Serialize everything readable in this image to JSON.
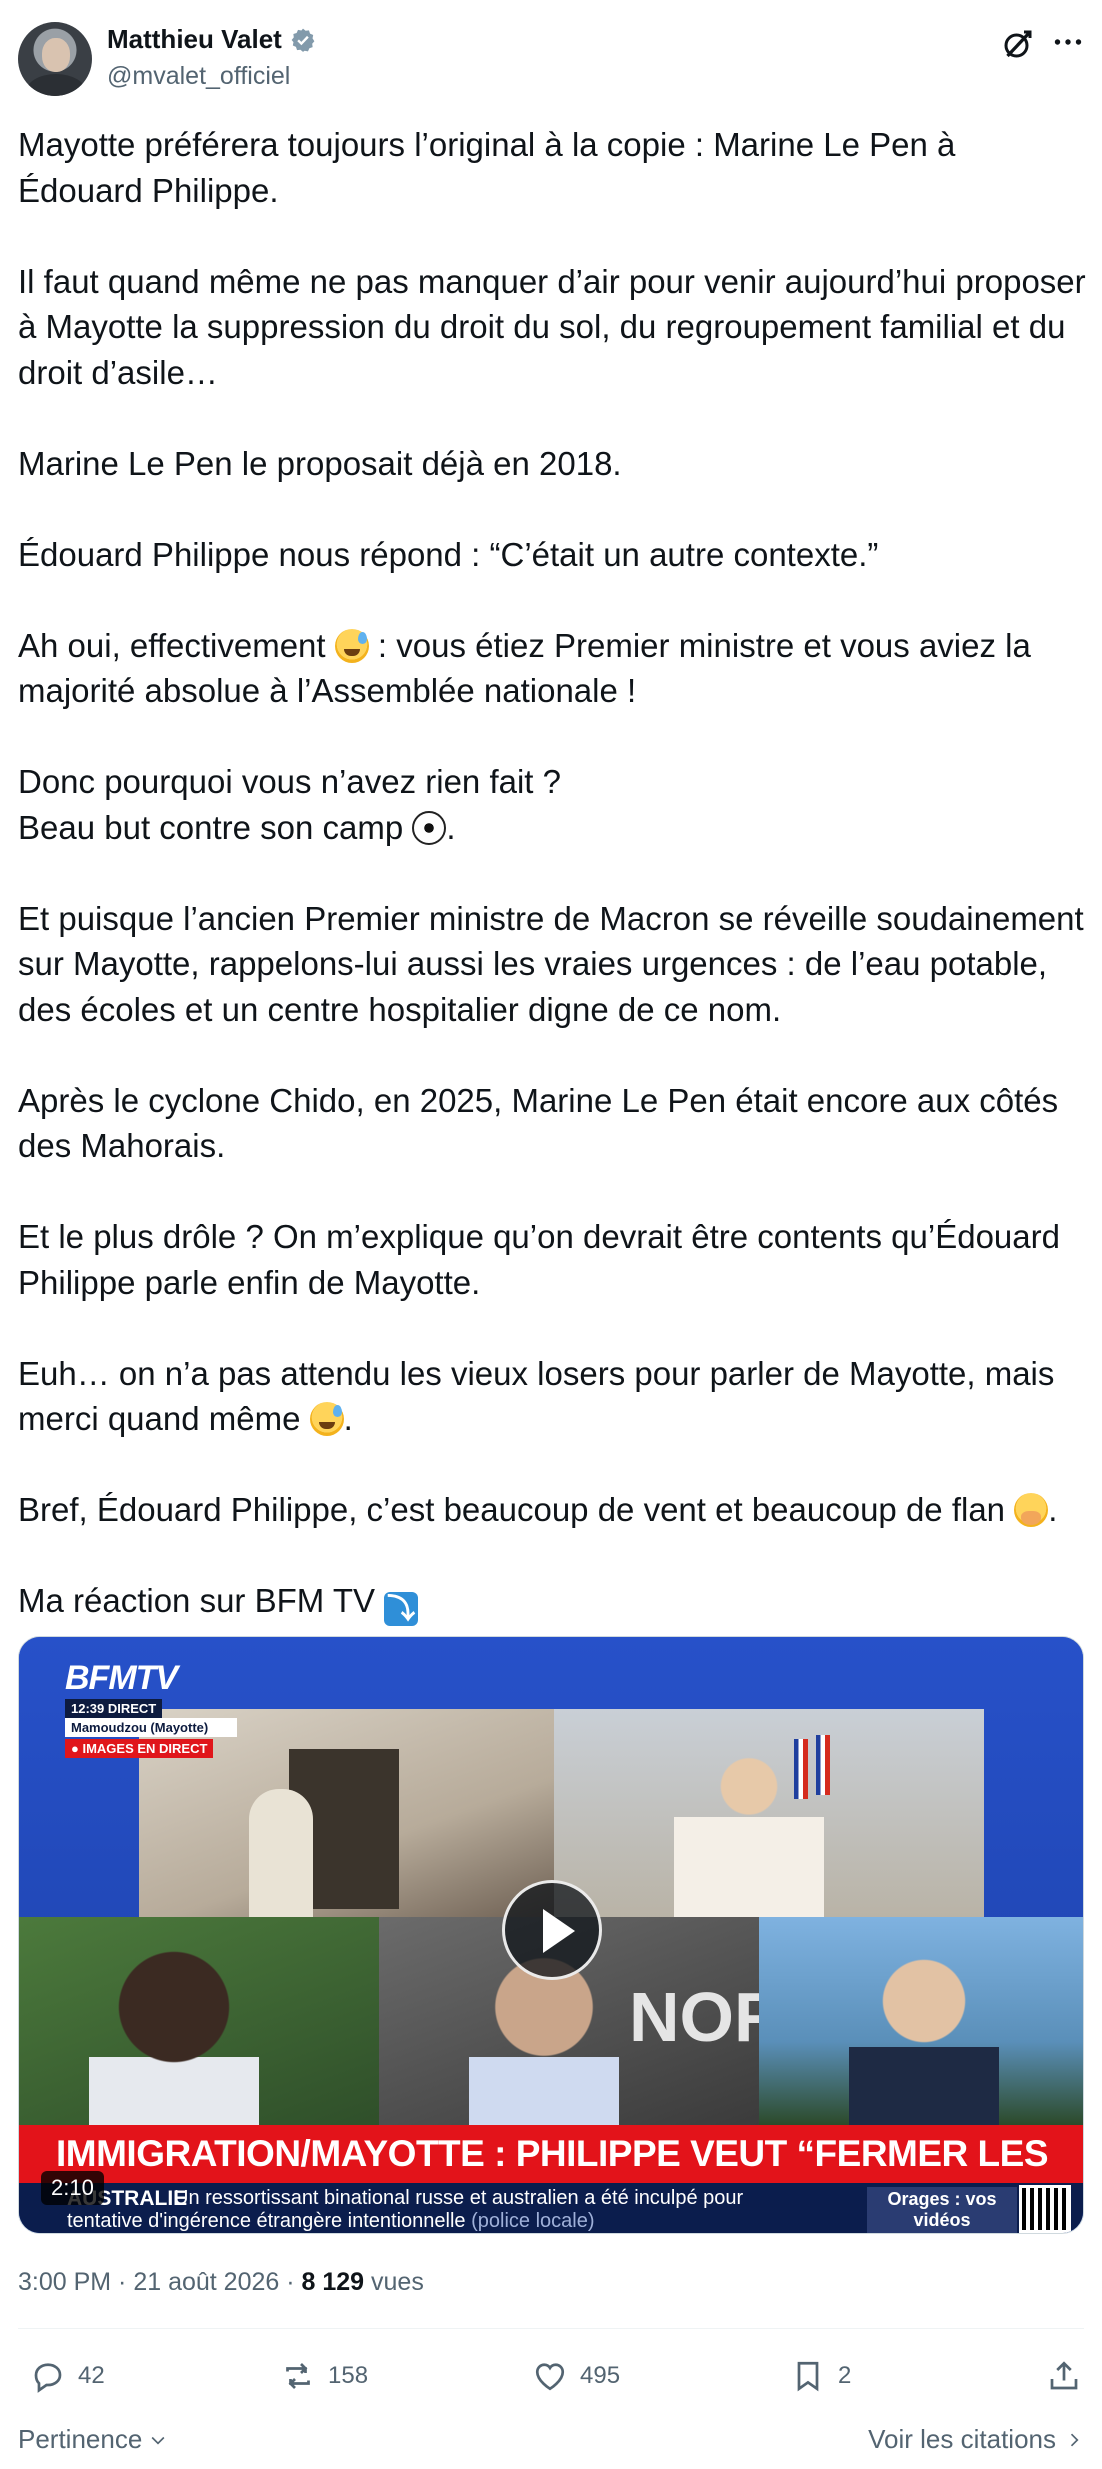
{
  "author": {
    "name": "Matthieu Valet",
    "handle": "@mvalet_officiel",
    "verified_color": "#829aab"
  },
  "post": {
    "paragraphs": [
      {
        "text": "Mayotte préférera toujours l’original à la copie : Marine Le Pen à Édouard Philippe.",
        "emoji": ""
      },
      {
        "text": "Il faut quand même ne pas manquer d’air pour venir aujourd’hui proposer à Mayotte la suppression du droit du sol, du regroupement familial et du droit d’asile…",
        "emoji": ""
      },
      {
        "text": "Marine Le Pen le proposait déjà en 2018.",
        "emoji": ""
      },
      {
        "text": "Édouard Philippe nous répond : “C’était un autre contexte.”",
        "emoji": ""
      }
    ],
    "p5_before": "Ah oui, effectivement ",
    "p5_after": " : vous étiez Premier ministre et vous aviez la majorité absolue à l’Assemblée nationale !",
    "p6_line1": "Donc pourquoi vous n’avez rien fait ?",
    "p6_line2_before": "Beau but contre son camp ",
    "p6_line2_after": ".",
    "p7": "Et puisque l’ancien Premier ministre de Macron se réveille soudainement sur Mayotte, rappelons-lui aussi les vraies urgences : de l’eau potable, des écoles et un centre hospitalier digne de ce nom.",
    "p8": "Après le cyclone Chido, en 2025, Marine Le Pen était encore aux côtés des Mahorais.",
    "p9": "Et le plus drôle ? On m’explique qu’on devrait être contents qu’Édouard Philippe parle enfin de Mayotte.",
    "p10_before": "Euh… on n’a pas attendu les vieux losers pour parler de Mayotte, mais merci quand même ",
    "p10_after": ".",
    "p11_before": "Bref, Édouard Philippe, c’est beaucoup de vent et beaucoup de flan ",
    "p11_after": ".",
    "p12_before": "Ma réaction sur BFM TV ",
    "p12_arrow": "⤵"
  },
  "video": {
    "channel_logo": "BFMTV",
    "live_time": "12:39 DIRECT",
    "live_location": "Mamoudzou (Mayotte)",
    "live_tag": "● IMAGES EN DIRECT",
    "headline": "IMMIGRATION/MAYOTTE : PHILIPPE VEUT “FERMER LES VANNES”",
    "ticker_country": "AUSTRALIE",
    "ticker_text_1": "Un ressortissant binational russe et australien a été inculpé pour",
    "ticker_text_2": "tentative d'ingérence étrangère intentionnelle",
    "ticker_source": "(police locale)",
    "promo": "Orages : vos vidéos",
    "panel_text": "NOR",
    "duration": "2:10"
  },
  "meta": {
    "time": "3:00 PM · 21 août 2026 · ",
    "views": "8 129",
    "views_label": " vues"
  },
  "actions": {
    "replies": "42",
    "reposts": "158",
    "likes": "495",
    "bookmarks": "2"
  },
  "footer": {
    "sort_label": "Pertinence",
    "quotes_label": "Voir les citations"
  },
  "colors": {
    "text": "#0f1419",
    "secondary": "#536471",
    "headline_red": "#e3131a",
    "bfm_blue": "#1f45b7"
  }
}
